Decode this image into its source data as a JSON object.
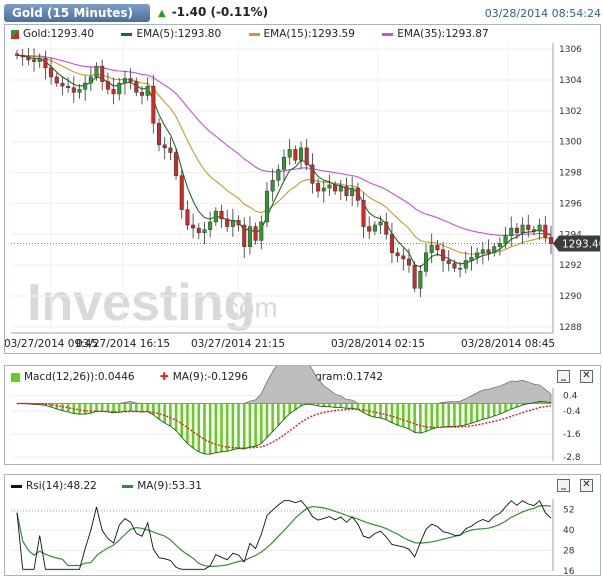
{
  "header": {
    "title": "Gold (15 Minutes)",
    "change": "-1.40 (-0.11%)",
    "timestamp": "03/28/2014 08:54:24"
  },
  "legend_main": {
    "symbol": "Gold:1293.40",
    "ema5": "EMA(5):1293.80",
    "ema15": "EMA(15):1293.59",
    "ema35": "EMA(35):1293.87"
  },
  "legend_macd": {
    "macd": "Macd(12,26)):0.0446",
    "ma": "MA(9):-0.1296",
    "hist": "Histogram:0.1742"
  },
  "legend_rsi": {
    "rsi": "Rsi(14):48.22",
    "ma": "MA(9):53.31"
  },
  "watermark": {
    "main": "Investing",
    "suffix": ".com"
  },
  "controls": {
    "minimize": "_",
    "close": "✕"
  },
  "colors": {
    "up": "#2f9a2f",
    "down": "#cc2b2b",
    "ema5": "#1e6b1e",
    "ema15": "#c99a2e",
    "ema35": "#c653d6",
    "macd_hist": "#66cc22",
    "macd_signal": "#e02020",
    "rsi": "#111111",
    "rsi_ma": "#3a8a3a",
    "price_tag": "#3c3c3c"
  },
  "chart_data": [
    {
      "type": "candlestick",
      "title": "Gold (15 Minutes)",
      "ylim": [
        1287.6,
        1306.4
      ],
      "y_ticks": [
        1306,
        1304,
        1302,
        1300,
        1298,
        1296,
        1294,
        1292,
        1290,
        1288
      ],
      "x_tick_labels": [
        "03/27/2014 09:45",
        "03/27/2014 16:15",
        "03/27/2014 21:15",
        "03/28/2014 02:15",
        "03/28/2014 08:45"
      ],
      "last_price": "1293.40",
      "last_value": 1293.4,
      "closes": [
        1305.6,
        1305.5,
        1305.3,
        1305.2,
        1305.4,
        1304.8,
        1304.2,
        1303.8,
        1303.6,
        1303.5,
        1303.2,
        1303.4,
        1303.8,
        1304.2,
        1304.9,
        1303.9,
        1303.4,
        1303.1,
        1303.8,
        1304.1,
        1303.9,
        1303.2,
        1303.0,
        1303.6,
        1301.2,
        1299.8,
        1299.6,
        1299.3,
        1297.8,
        1295.6,
        1294.6,
        1294.4,
        1294.1,
        1294.3,
        1294.8,
        1295.5,
        1295.0,
        1294.5,
        1294.9,
        1294.6,
        1293.2,
        1294.5,
        1293.6,
        1294.8,
        1296.8,
        1297.5,
        1298.2,
        1299.0,
        1299.5,
        1298.8,
        1299.6,
        1298.5,
        1297.3,
        1296.8,
        1297.0,
        1297.2,
        1296.8,
        1297.1,
        1296.5,
        1297.0,
        1296.2,
        1294.5,
        1294.2,
        1294.6,
        1294.8,
        1294.0,
        1292.8,
        1292.6,
        1292.4,
        1292.0,
        1290.5,
        1291.6,
        1292.8,
        1293.3,
        1293.0,
        1292.3,
        1292.1,
        1291.8,
        1291.8,
        1292.3,
        1292.5,
        1292.8,
        1293.0,
        1292.8,
        1293.2,
        1293.4,
        1293.9,
        1294.4,
        1294.1,
        1294.6,
        1294.3,
        1294.2,
        1294.6,
        1293.8,
        1293.4
      ],
      "ema5_last": 1293.8,
      "ema15_last": 1293.59,
      "ema35_last": 1293.87
    },
    {
      "type": "bar",
      "title": "Macd(12,26))",
      "ylim": [
        -3.0,
        0.8
      ],
      "y_ticks": [
        0.4,
        -0.4,
        -1.6,
        -2.8
      ],
      "macd_last": 0.0446,
      "signal_last": -0.1296,
      "histogram_last": 0.1742
    },
    {
      "type": "line",
      "title": "Rsi(14)",
      "ylim": [
        16,
        58
      ],
      "y_ticks": [
        52,
        40,
        28,
        16
      ],
      "rsi_last": 48.22,
      "ma_last": 53.31
    }
  ]
}
